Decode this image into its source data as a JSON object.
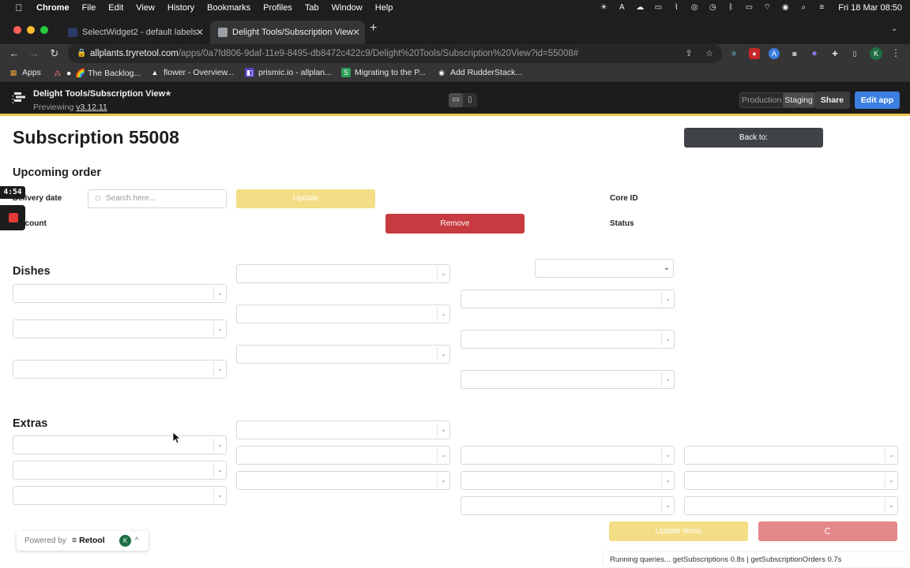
{
  "menubar": {
    "app": "Chrome",
    "items": [
      "File",
      "Edit",
      "View",
      "History",
      "Bookmarks",
      "Profiles",
      "Tab",
      "Window",
      "Help"
    ],
    "clock": "Fri 18 Mar  08:50"
  },
  "browser": {
    "tabs": [
      {
        "title": "SelectWidget2 - default labels",
        "active": false
      },
      {
        "title": "Delight Tools/Subscription View",
        "active": true
      }
    ],
    "url_host": "allplants.tryretool.com",
    "url_path": "/apps/0a7fd806-9daf-11e9-8495-db8472c422c9/Delight%20Tools/Subscription%20View?id=55008#",
    "bookmarks": [
      {
        "label": "Apps",
        "icon": "apps-grid-icon"
      },
      {
        "label": "🌈 The Backlog...",
        "icon": "backlog-icon"
      },
      {
        "label": "flower - Overview...",
        "icon": "flower-icon"
      },
      {
        "label": "prismic.io - allplan...",
        "icon": "prismic-icon"
      },
      {
        "label": "Migrating to the P...",
        "icon": "migrating-icon"
      },
      {
        "label": "Add RudderStack...",
        "icon": "github-icon"
      }
    ],
    "profile_initial": "K"
  },
  "retool_header": {
    "app_title": "Delight Tools/Subscription View",
    "preview_prefix": "Previewing",
    "version": "v3.12.11",
    "env_production": "Production",
    "env_staging": "Staging",
    "share_label": "Share",
    "edit_label": "Edit app"
  },
  "page": {
    "title": "Subscription 55008",
    "back_button": "Back to:",
    "upcoming_order": "Upcoming order",
    "delivery_date_label": "Delivery date",
    "search_placeholder": "Search here...",
    "update_button": "Update",
    "core_id_label": "Core ID",
    "discount_label": "Discount",
    "remove_button": "Remove",
    "status_label": "Status",
    "dishes_heading": "Dishes",
    "extras_heading": "Extras",
    "update_items_button": "Update items",
    "colors": {
      "yellow": "#f3dd85",
      "red": "#c73a3f",
      "red_faded": "#e4878b",
      "dark_button": "#3f4246"
    }
  },
  "recording": {
    "time": "4:54"
  },
  "powered_by": {
    "prefix": "Powered by",
    "brand": "Retool",
    "avatar": "K"
  },
  "status_bar": "Running queries... getSubscriptions 0.8s | getSubscriptionOrders 0.7s"
}
